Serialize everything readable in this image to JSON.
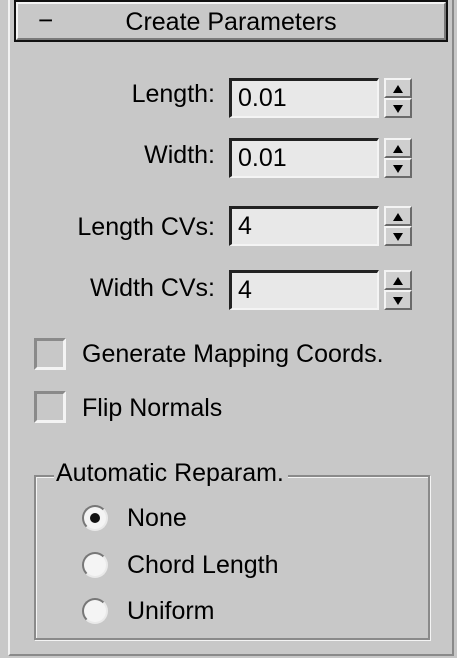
{
  "rollout": {
    "collapse_sign": "−",
    "title": "Create Parameters"
  },
  "params": [
    {
      "label": "Length:",
      "value": "0.01"
    },
    {
      "label": "Width:",
      "value": "0.01"
    },
    {
      "label": "Length CVs:",
      "value": "4"
    },
    {
      "label": "Width CVs:",
      "value": "4"
    }
  ],
  "checkboxes": [
    {
      "label": "Generate Mapping Coords.",
      "checked": false
    },
    {
      "label": "Flip Normals",
      "checked": false
    }
  ],
  "reparam": {
    "title": "Automatic Reparam.",
    "options": [
      {
        "label": "None",
        "selected": true
      },
      {
        "label": "Chord Length",
        "selected": false
      },
      {
        "label": "Uniform",
        "selected": false
      }
    ]
  }
}
